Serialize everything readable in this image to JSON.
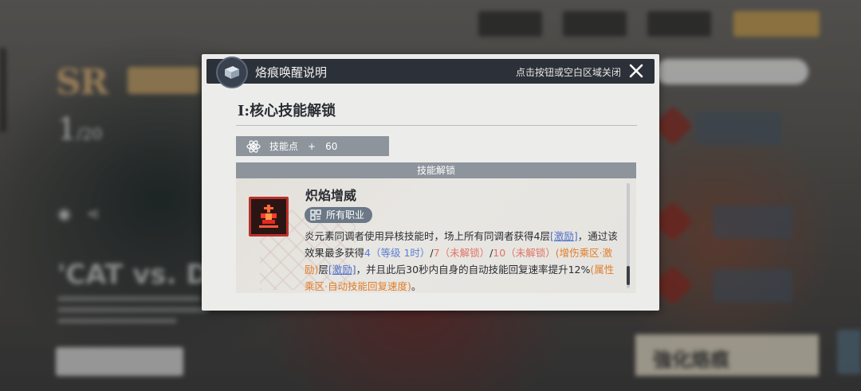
{
  "background": {
    "rarity": "SR",
    "level_current": "1",
    "level_max": "/20",
    "title_fragment": "'CAT vs. DO",
    "strengthen_label": "強化烙痕"
  },
  "dialog": {
    "title": "烙痕唤醒说明",
    "close_hint": "点击按钮或空白区域关闭",
    "section_title": "I:核心技能解锁",
    "skill_points": {
      "label": "技能点",
      "plus": "+",
      "value": "60"
    },
    "unlock_header": "技能解锁",
    "skill": {
      "name": "炽焰增威",
      "tag": "所有职业",
      "desc": {
        "p1": "炎元素同调者使用异核技能时，场上所有同调者获得4层",
        "kw1": "[激励]",
        "p2": "，通过该效果最多获得",
        "lv1": "4（等级 1时）",
        "sep1": "/",
        "lv2": "7（未解锁）",
        "sep2": "/",
        "lv3": "10（未解锁）",
        "mod1": "(增伤乘区·激励)",
        "p3": "层",
        "kw2": "[激励]",
        "p4": "，并且此后30秒内自身的自动技能回复速率提升12%",
        "mod2": "(属性乘区·自动技能回复速度)",
        "p5": "。"
      }
    }
  },
  "colors": {
    "header_bg": "#2c3038",
    "panel_bg": "#ececea",
    "bar_gray": "#8d949c",
    "keyword_blue": "#4e6fc9",
    "level_red": "#e07466",
    "modifier_orange": "#e07e2a",
    "skill_icon_red": "#b9322a"
  },
  "icons": [
    "book-icon",
    "close-icon",
    "atom-icon",
    "skill-flame-icon",
    "job-grid-icon"
  ]
}
